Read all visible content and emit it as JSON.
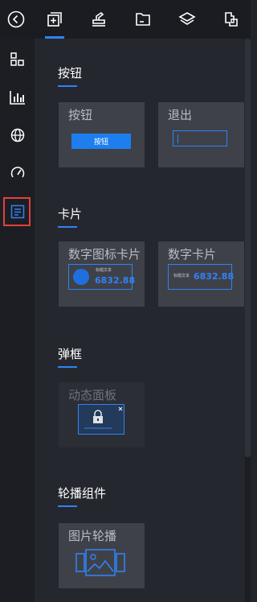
{
  "accent": "#2f82f5",
  "highlight": "#e0413d",
  "toolbar": {
    "items": [
      {
        "icon": "back-icon"
      },
      {
        "icon": "add-component-icon",
        "active": true
      },
      {
        "icon": "stamp-icon"
      },
      {
        "icon": "folder-icon"
      },
      {
        "icon": "layers-icon"
      },
      {
        "icon": "puzzle-icon"
      }
    ]
  },
  "sidebar": {
    "items": [
      {
        "icon": "grid-icon"
      },
      {
        "icon": "bar-chart-icon"
      },
      {
        "icon": "globe-icon"
      },
      {
        "icon": "gauge-icon"
      },
      {
        "icon": "panel-icon",
        "active": true
      }
    ]
  },
  "sections": {
    "buttons": {
      "title": "按钮",
      "cards": [
        {
          "label": "按钮",
          "preview_text": "按钮"
        },
        {
          "label": "退出"
        }
      ]
    },
    "cards": {
      "title": "卡片",
      "cards": [
        {
          "label": "数字图标卡片",
          "small_text": "标题文本",
          "value": "6832.88"
        },
        {
          "label": "数字卡片",
          "small_text": "标题文本",
          "value": "6832.88"
        }
      ]
    },
    "popups": {
      "title": "弹框",
      "cards": [
        {
          "label": "动态面板"
        }
      ]
    },
    "carousel": {
      "title": "轮播组件",
      "cards": [
        {
          "label": "图片轮播"
        }
      ]
    }
  }
}
